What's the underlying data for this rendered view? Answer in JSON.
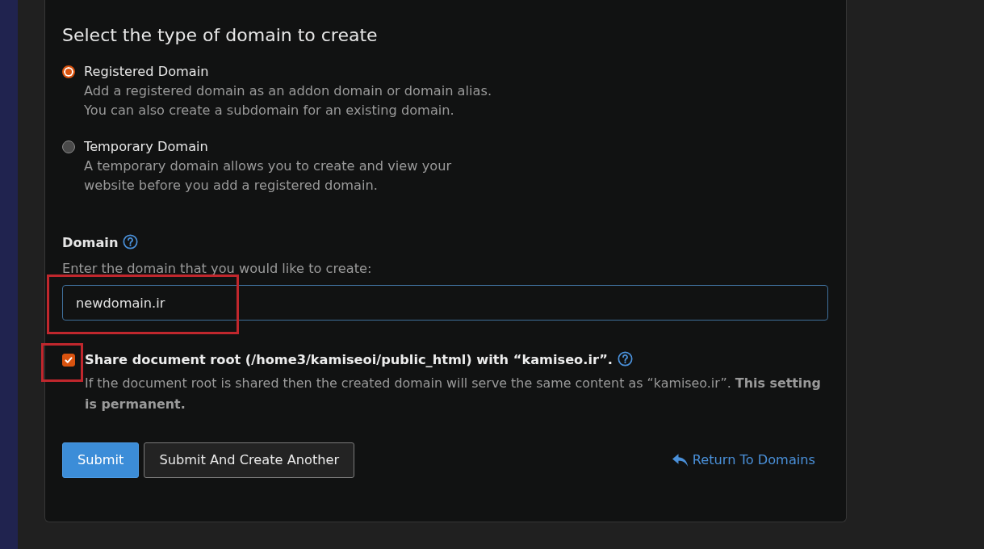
{
  "heading": "Select the type of domain to create",
  "domain_types": [
    {
      "label": "Registered Domain",
      "description": "Add a registered domain as an addon domain or domain alias.\nYou can also create a subdomain for an existing domain.",
      "selected": true
    },
    {
      "label": "Temporary Domain",
      "description": "A temporary domain allows you to create and view your\nwebsite before you add a registered domain.",
      "selected": false
    }
  ],
  "domain_field": {
    "label": "Domain",
    "hint": "Enter the domain that you would like to create:",
    "value": "newdomain.ir",
    "highlighted": true
  },
  "share_root": {
    "label": "Share document root (/home3/kamiseoi/public_html) with “kamiseo.ir”.",
    "checked": true,
    "description": "If the document root is shared then the created domain will serve the same content as “kamiseo.ir”. **This setting is permanent.**",
    "highlighted": true
  },
  "buttons": [
    {
      "label": "Submit",
      "kind": "primary"
    },
    {
      "label": "Submit And Create Another",
      "kind": "secondary"
    }
  ],
  "return_link": {
    "label": "Return To Domains"
  }
}
